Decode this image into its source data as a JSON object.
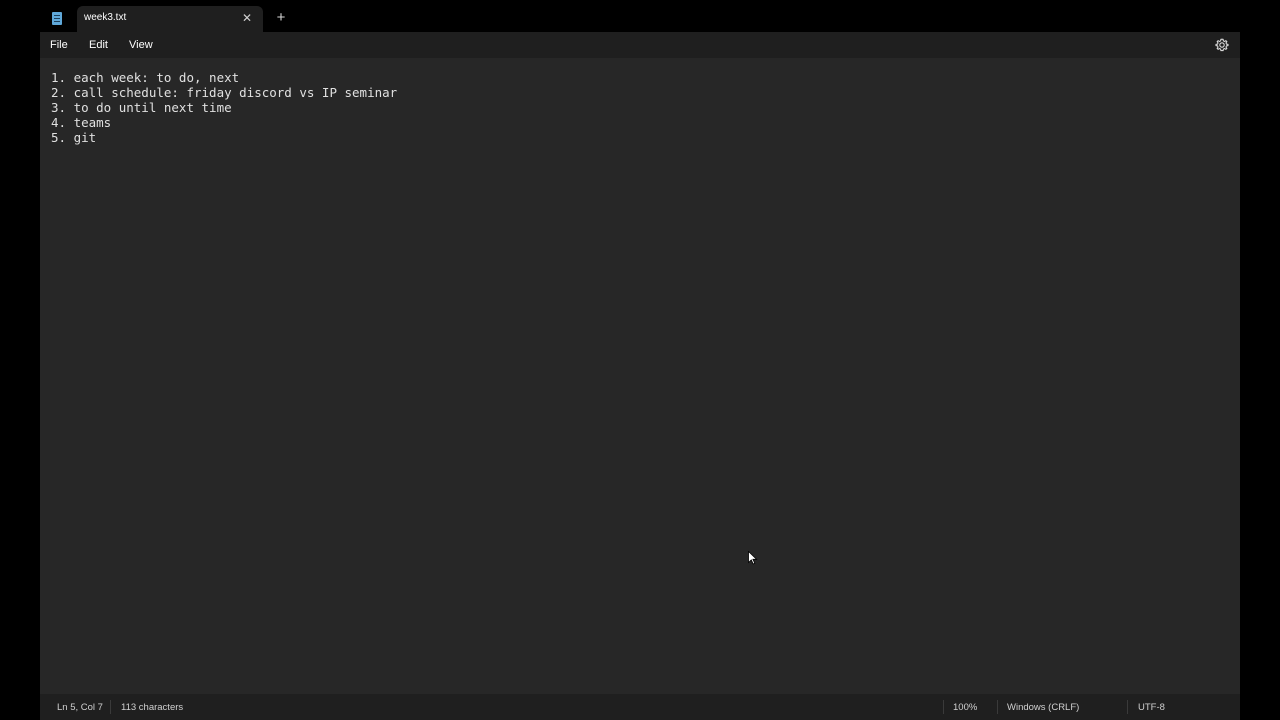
{
  "tabs": [
    {
      "title": "week3.txt",
      "active": true
    }
  ],
  "menu": {
    "file": "File",
    "edit": "Edit",
    "view": "View"
  },
  "editor": {
    "lines": [
      "1. each week: to do, next",
      "2. call schedule: friday discord vs IP seminar",
      "3. to do until next time",
      "4. teams",
      "5. git"
    ]
  },
  "status": {
    "position": "Ln 5, Col 7",
    "characters": "113 characters",
    "zoom": "100%",
    "line_ending": "Windows (CRLF)",
    "encoding": "UTF-8"
  },
  "icons": {
    "app": "notepad-icon",
    "close": "close-icon",
    "new_tab": "plus-icon",
    "settings": "gear-icon"
  },
  "colors": {
    "background": "#272727",
    "chrome": "#1f1f1f",
    "titlebar": "#000000",
    "text": "#e0e0e0",
    "accent": "#5fa8d9"
  }
}
